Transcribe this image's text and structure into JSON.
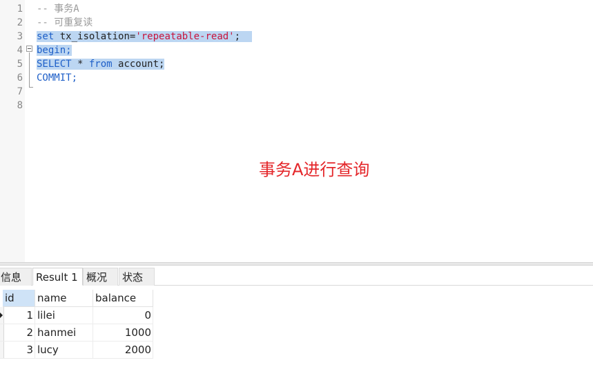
{
  "editor": {
    "line_numbers": [
      "1",
      "2",
      "3",
      "4",
      "5",
      "6",
      "7",
      "8"
    ],
    "lines": {
      "l1": "-- 事务A",
      "l2": "-- 可重复读",
      "l3_kw": "set",
      "l3_mid": " tx_isolation=",
      "l3_str": "'repeatable-read'",
      "l3_end": ";",
      "l4": "begin;",
      "l5_kw1": "SELECT",
      "l5_mid": " * ",
      "l5_kw2": "from",
      "l5_end": " account;",
      "l6": "COMMIT;"
    }
  },
  "annotation": "事务A进行查询",
  "tabs": [
    "信息",
    "Result 1",
    "概况",
    "状态"
  ],
  "active_tab": "Result 1",
  "result": {
    "columns": [
      "id",
      "name",
      "balance"
    ],
    "rows": [
      [
        "1",
        "lilei",
        "0"
      ],
      [
        "2",
        "hanmei",
        "1000"
      ],
      [
        "3",
        "lucy",
        "2000"
      ]
    ]
  },
  "colors": {
    "keyword": "#1e5fc8",
    "string": "#c8143c",
    "comment": "#9a9a9a",
    "selection": "#bcd6f2",
    "annotation": "#e4262a"
  }
}
